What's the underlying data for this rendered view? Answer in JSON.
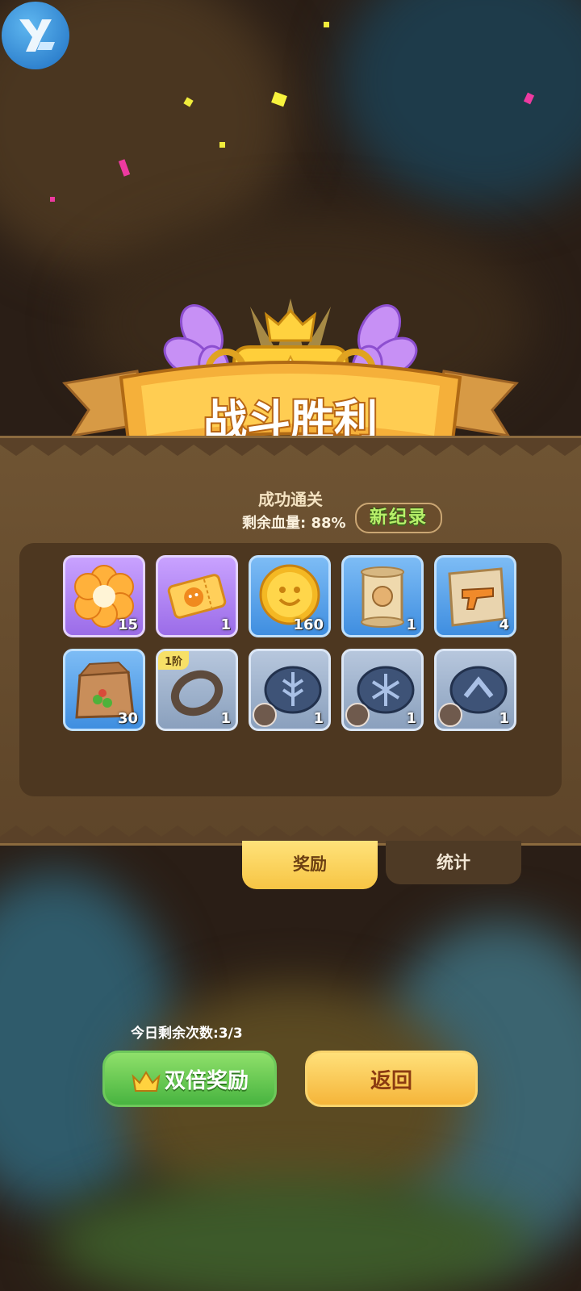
{
  "banner": {
    "title": "战斗胜利"
  },
  "result": {
    "subtitle": "成功通关",
    "hp_label": "剩余血量:",
    "hp_value": "88%",
    "new_record": "新纪录"
  },
  "rewards": {
    "row1": [
      {
        "icon": "orange-flower-icon",
        "count": "15"
      },
      {
        "icon": "ticket-icon",
        "count": "1"
      },
      {
        "icon": "gold-coin-icon",
        "count": "160"
      },
      {
        "icon": "pet-scroll-icon",
        "count": "1"
      },
      {
        "icon": "gun-blueprint-icon",
        "count": "4"
      }
    ],
    "row2": [
      {
        "icon": "seed-bag-icon",
        "count": "30"
      },
      {
        "icon": "ring-icon",
        "count": "1",
        "tier": "1阶"
      },
      {
        "icon": "rune-stone-armor-icon",
        "count": "1"
      },
      {
        "icon": "rune-stone-boots-icon",
        "count": "1"
      },
      {
        "icon": "rune-stone-ring-icon",
        "count": "1"
      }
    ]
  },
  "tabs": {
    "rewards": "奖励",
    "stats": "统计"
  },
  "footer": {
    "remaining_times": "今日剩余次数:3/3",
    "double_reward": "双倍奖励",
    "back": "返回"
  },
  "colors": {
    "panel": "#6f5433",
    "gold": "#f7c544",
    "green_button": "#48b440"
  }
}
